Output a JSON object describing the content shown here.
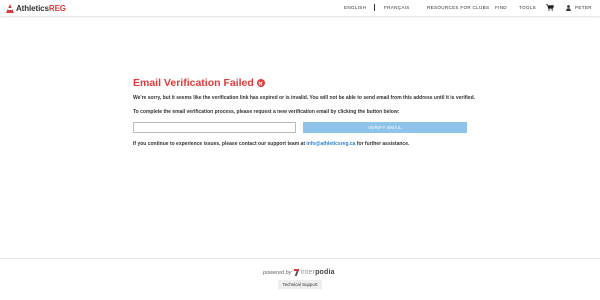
{
  "header": {
    "logo_prefix": "Athletics",
    "logo_suffix": "REG",
    "nav": {
      "english": "ENGLISH",
      "french": "FRANÇAIS",
      "resources": "RESOURCES FOR CLUBS",
      "find": "FIND",
      "tools": "TOOLS",
      "user": "PETER"
    },
    "icons": {
      "cart": "shopping-cart-icon",
      "user": "user-icon"
    }
  },
  "main": {
    "title": "Email Verification Failed",
    "line1": "We're sorry, but it seems like the verification link has expired or is invalid. You will not be able to send email from this address until it is verified.",
    "line2": "To complete the email verification process, please request a new verification email by clicking the button below:",
    "email_value": "",
    "verify_button": "VERIFY EMAIL",
    "support_prefix": "If you continue to experience issues, please contact our support team at",
    "support_email": "info@athleticsreg.ca",
    "support_suffix": "for further assistance.",
    "colors": {
      "error": "#e03b3b",
      "button": "#8fc4ea",
      "link": "#2a7fc9"
    }
  },
  "footer": {
    "powered_by": "powered by",
    "brand_light": "inter",
    "brand_bold": "podia",
    "tech_support": "Technical Support"
  }
}
